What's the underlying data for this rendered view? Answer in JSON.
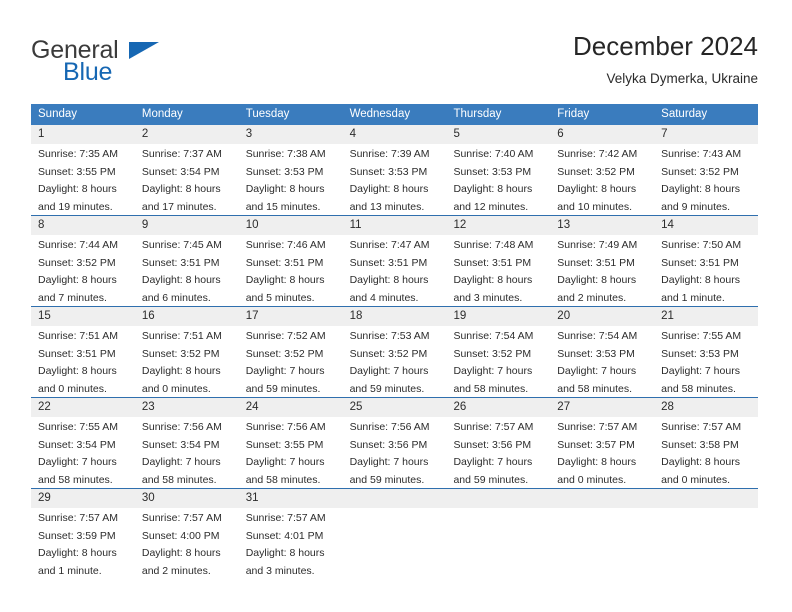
{
  "brand": {
    "name_part1": "General",
    "name_part2": "Blue",
    "triangle_icon": "triangle-icon",
    "accent_color": "#1667b3"
  },
  "header": {
    "title": "December 2024",
    "subtitle": "Velyka Dymerka, Ukraine"
  },
  "theme": {
    "header_bg": "#3a7cbe",
    "date_band_bg": "#efefef",
    "rule_color": "#2f6fae",
    "text_color": "#2c2c2c"
  },
  "weekdays": [
    "Sunday",
    "Monday",
    "Tuesday",
    "Wednesday",
    "Thursday",
    "Friday",
    "Saturday"
  ],
  "weeks": [
    {
      "days": [
        {
          "num": "1",
          "sunrise": "Sunrise: 7:35 AM",
          "sunset": "Sunset: 3:55 PM",
          "daylight_line1": "Daylight: 8 hours",
          "daylight_line2": "and 19 minutes."
        },
        {
          "num": "2",
          "sunrise": "Sunrise: 7:37 AM",
          "sunset": "Sunset: 3:54 PM",
          "daylight_line1": "Daylight: 8 hours",
          "daylight_line2": "and 17 minutes."
        },
        {
          "num": "3",
          "sunrise": "Sunrise: 7:38 AM",
          "sunset": "Sunset: 3:53 PM",
          "daylight_line1": "Daylight: 8 hours",
          "daylight_line2": "and 15 minutes."
        },
        {
          "num": "4",
          "sunrise": "Sunrise: 7:39 AM",
          "sunset": "Sunset: 3:53 PM",
          "daylight_line1": "Daylight: 8 hours",
          "daylight_line2": "and 13 minutes."
        },
        {
          "num": "5",
          "sunrise": "Sunrise: 7:40 AM",
          "sunset": "Sunset: 3:53 PM",
          "daylight_line1": "Daylight: 8 hours",
          "daylight_line2": "and 12 minutes."
        },
        {
          "num": "6",
          "sunrise": "Sunrise: 7:42 AM",
          "sunset": "Sunset: 3:52 PM",
          "daylight_line1": "Daylight: 8 hours",
          "daylight_line2": "and 10 minutes."
        },
        {
          "num": "7",
          "sunrise": "Sunrise: 7:43 AM",
          "sunset": "Sunset: 3:52 PM",
          "daylight_line1": "Daylight: 8 hours",
          "daylight_line2": "and 9 minutes."
        }
      ]
    },
    {
      "days": [
        {
          "num": "8",
          "sunrise": "Sunrise: 7:44 AM",
          "sunset": "Sunset: 3:52 PM",
          "daylight_line1": "Daylight: 8 hours",
          "daylight_line2": "and 7 minutes."
        },
        {
          "num": "9",
          "sunrise": "Sunrise: 7:45 AM",
          "sunset": "Sunset: 3:51 PM",
          "daylight_line1": "Daylight: 8 hours",
          "daylight_line2": "and 6 minutes."
        },
        {
          "num": "10",
          "sunrise": "Sunrise: 7:46 AM",
          "sunset": "Sunset: 3:51 PM",
          "daylight_line1": "Daylight: 8 hours",
          "daylight_line2": "and 5 minutes."
        },
        {
          "num": "11",
          "sunrise": "Sunrise: 7:47 AM",
          "sunset": "Sunset: 3:51 PM",
          "daylight_line1": "Daylight: 8 hours",
          "daylight_line2": "and 4 minutes."
        },
        {
          "num": "12",
          "sunrise": "Sunrise: 7:48 AM",
          "sunset": "Sunset: 3:51 PM",
          "daylight_line1": "Daylight: 8 hours",
          "daylight_line2": "and 3 minutes."
        },
        {
          "num": "13",
          "sunrise": "Sunrise: 7:49 AM",
          "sunset": "Sunset: 3:51 PM",
          "daylight_line1": "Daylight: 8 hours",
          "daylight_line2": "and 2 minutes."
        },
        {
          "num": "14",
          "sunrise": "Sunrise: 7:50 AM",
          "sunset": "Sunset: 3:51 PM",
          "daylight_line1": "Daylight: 8 hours",
          "daylight_line2": "and 1 minute."
        }
      ]
    },
    {
      "days": [
        {
          "num": "15",
          "sunrise": "Sunrise: 7:51 AM",
          "sunset": "Sunset: 3:51 PM",
          "daylight_line1": "Daylight: 8 hours",
          "daylight_line2": "and 0 minutes."
        },
        {
          "num": "16",
          "sunrise": "Sunrise: 7:51 AM",
          "sunset": "Sunset: 3:52 PM",
          "daylight_line1": "Daylight: 8 hours",
          "daylight_line2": "and 0 minutes."
        },
        {
          "num": "17",
          "sunrise": "Sunrise: 7:52 AM",
          "sunset": "Sunset: 3:52 PM",
          "daylight_line1": "Daylight: 7 hours",
          "daylight_line2": "and 59 minutes."
        },
        {
          "num": "18",
          "sunrise": "Sunrise: 7:53 AM",
          "sunset": "Sunset: 3:52 PM",
          "daylight_line1": "Daylight: 7 hours",
          "daylight_line2": "and 59 minutes."
        },
        {
          "num": "19",
          "sunrise": "Sunrise: 7:54 AM",
          "sunset": "Sunset: 3:52 PM",
          "daylight_line1": "Daylight: 7 hours",
          "daylight_line2": "and 58 minutes."
        },
        {
          "num": "20",
          "sunrise": "Sunrise: 7:54 AM",
          "sunset": "Sunset: 3:53 PM",
          "daylight_line1": "Daylight: 7 hours",
          "daylight_line2": "and 58 minutes."
        },
        {
          "num": "21",
          "sunrise": "Sunrise: 7:55 AM",
          "sunset": "Sunset: 3:53 PM",
          "daylight_line1": "Daylight: 7 hours",
          "daylight_line2": "and 58 minutes."
        }
      ]
    },
    {
      "days": [
        {
          "num": "22",
          "sunrise": "Sunrise: 7:55 AM",
          "sunset": "Sunset: 3:54 PM",
          "daylight_line1": "Daylight: 7 hours",
          "daylight_line2": "and 58 minutes."
        },
        {
          "num": "23",
          "sunrise": "Sunrise: 7:56 AM",
          "sunset": "Sunset: 3:54 PM",
          "daylight_line1": "Daylight: 7 hours",
          "daylight_line2": "and 58 minutes."
        },
        {
          "num": "24",
          "sunrise": "Sunrise: 7:56 AM",
          "sunset": "Sunset: 3:55 PM",
          "daylight_line1": "Daylight: 7 hours",
          "daylight_line2": "and 58 minutes."
        },
        {
          "num": "25",
          "sunrise": "Sunrise: 7:56 AM",
          "sunset": "Sunset: 3:56 PM",
          "daylight_line1": "Daylight: 7 hours",
          "daylight_line2": "and 59 minutes."
        },
        {
          "num": "26",
          "sunrise": "Sunrise: 7:57 AM",
          "sunset": "Sunset: 3:56 PM",
          "daylight_line1": "Daylight: 7 hours",
          "daylight_line2": "and 59 minutes."
        },
        {
          "num": "27",
          "sunrise": "Sunrise: 7:57 AM",
          "sunset": "Sunset: 3:57 PM",
          "daylight_line1": "Daylight: 8 hours",
          "daylight_line2": "and 0 minutes."
        },
        {
          "num": "28",
          "sunrise": "Sunrise: 7:57 AM",
          "sunset": "Sunset: 3:58 PM",
          "daylight_line1": "Daylight: 8 hours",
          "daylight_line2": "and 0 minutes."
        }
      ]
    },
    {
      "days": [
        {
          "num": "29",
          "sunrise": "Sunrise: 7:57 AM",
          "sunset": "Sunset: 3:59 PM",
          "daylight_line1": "Daylight: 8 hours",
          "daylight_line2": "and 1 minute."
        },
        {
          "num": "30",
          "sunrise": "Sunrise: 7:57 AM",
          "sunset": "Sunset: 4:00 PM",
          "daylight_line1": "Daylight: 8 hours",
          "daylight_line2": "and 2 minutes."
        },
        {
          "num": "31",
          "sunrise": "Sunrise: 7:57 AM",
          "sunset": "Sunset: 4:01 PM",
          "daylight_line1": "Daylight: 8 hours",
          "daylight_line2": "and 3 minutes."
        },
        {
          "num": "",
          "sunrise": "",
          "sunset": "",
          "daylight_line1": "",
          "daylight_line2": ""
        },
        {
          "num": "",
          "sunrise": "",
          "sunset": "",
          "daylight_line1": "",
          "daylight_line2": ""
        },
        {
          "num": "",
          "sunrise": "",
          "sunset": "",
          "daylight_line1": "",
          "daylight_line2": ""
        },
        {
          "num": "",
          "sunrise": "",
          "sunset": "",
          "daylight_line1": "",
          "daylight_line2": ""
        }
      ]
    }
  ]
}
